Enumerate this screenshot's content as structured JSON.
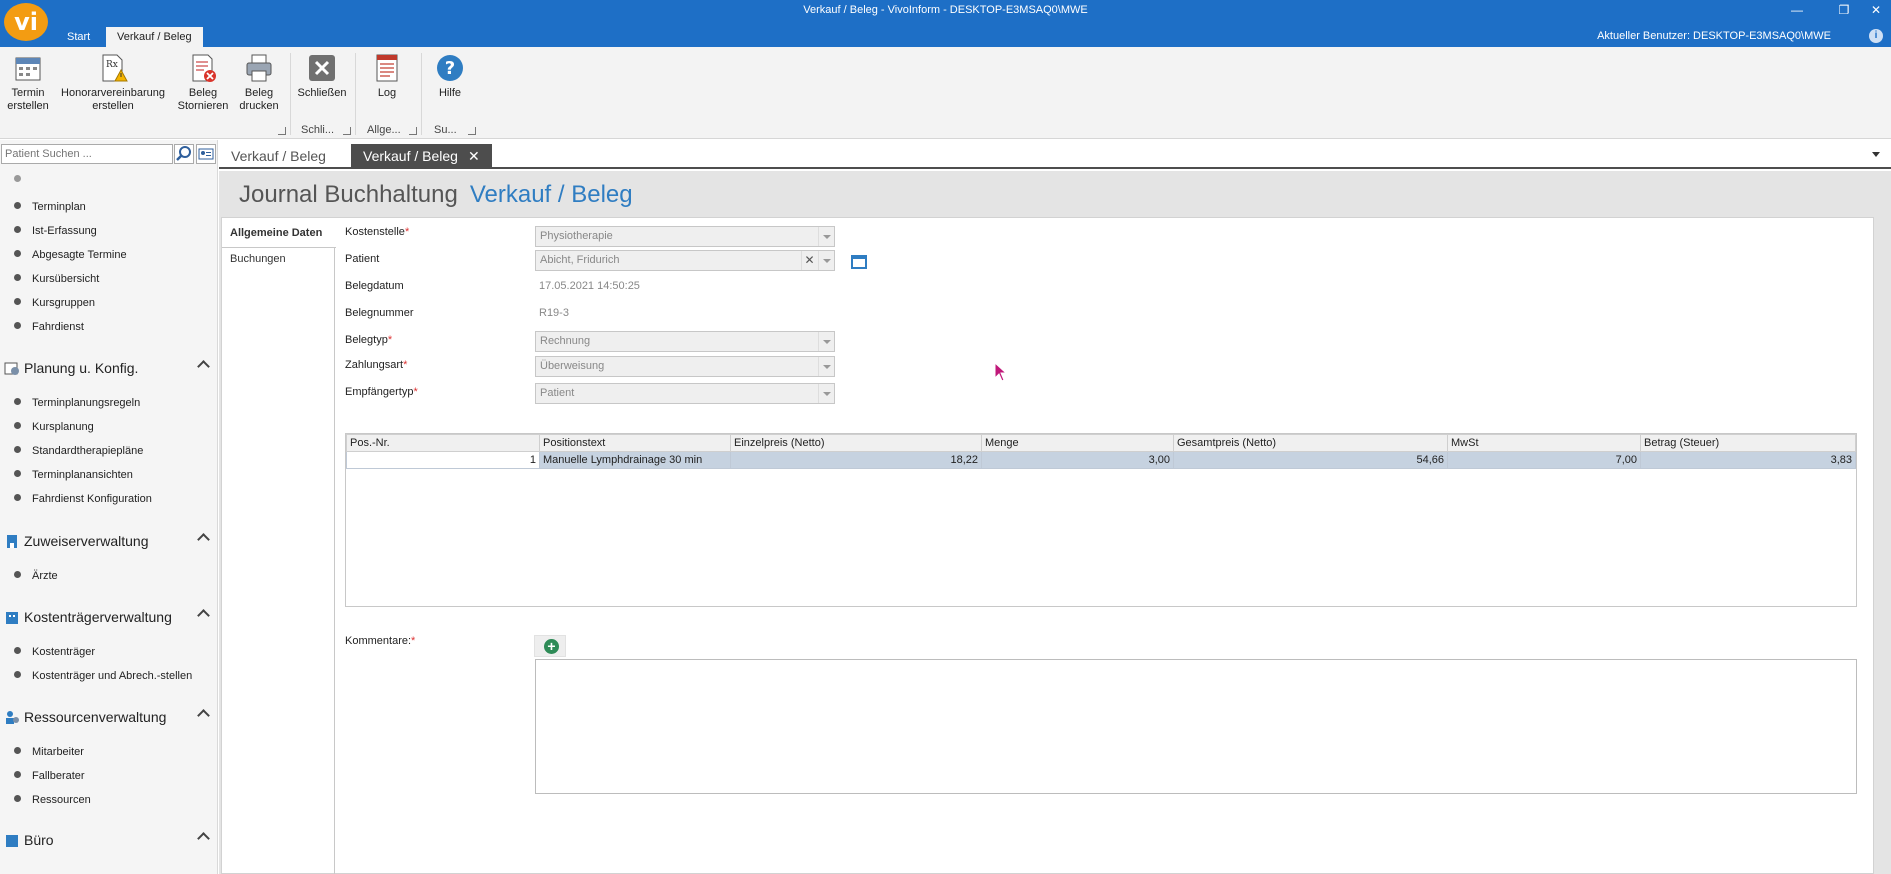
{
  "window": {
    "title": "Verkauf / Beleg - VivoInform - DESKTOP-E3MSAQ0\\MWE",
    "logo_text": "vi",
    "user_label": "Aktueller Benutzer: DESKTOP-E3MSAQ0\\MWE",
    "info_glyph": "i",
    "minimize_glyph": "—",
    "restore_glyph": "❐",
    "close_glyph": "✕"
  },
  "ribbon_tabs": [
    {
      "label": "Start"
    },
    {
      "label": "Verkauf / Beleg"
    }
  ],
  "ribbon": {
    "buttons": [
      {
        "label": "Termin\nerstellen",
        "icon": "calendar-icon"
      },
      {
        "label": "Honorarvereinbarung\nerstellen",
        "icon": "prescription-warning-icon"
      },
      {
        "label": "Beleg\nStornieren",
        "icon": "cancel-document-icon"
      },
      {
        "label": "Beleg\ndrucken",
        "icon": "printer-icon"
      },
      {
        "label": "Schließen",
        "icon": "close-box-icon"
      },
      {
        "label": "Log",
        "icon": "log-icon"
      },
      {
        "label": "Hilfe",
        "icon": "help-icon"
      }
    ],
    "groups": [
      "Schli...",
      "Allge...",
      "Su..."
    ]
  },
  "left_panel": {
    "search_placeholder": "Patient Suchen ...",
    "top_items": [
      "Terminplan",
      "Ist-Erfassung",
      "Abgesagte Termine",
      "Kursübersicht",
      "Kursgruppen",
      "Fahrdienst"
    ],
    "sections": [
      {
        "title": "Planung u. Konfig.",
        "items": [
          "Terminplanungsregeln",
          "Kursplanung",
          "Standardtherapiepläne",
          "Terminplanansichten",
          "Fahrdienst Konfiguration"
        ]
      },
      {
        "title": "Zuweiserverwaltung",
        "items": [
          "Ärzte"
        ]
      },
      {
        "title": "Kostenträgerverwaltung",
        "items": [
          "Kostenträger",
          "Kostenträger und Abrech.-stellen"
        ]
      },
      {
        "title": "Ressourcenverwaltung",
        "items": [
          "Mitarbeiter",
          "Fallberater",
          "Ressourcen"
        ]
      },
      {
        "title": "Büro",
        "items": []
      }
    ]
  },
  "doc_tabs": [
    {
      "label": "Verkauf / Beleg"
    },
    {
      "label": "Verkauf / Beleg",
      "close": "✕"
    }
  ],
  "breadcrumb": {
    "parent": "Journal Buchhaltung",
    "current": "Verkauf / Beleg"
  },
  "side_tabs": [
    "Allgemeine Daten",
    "Buchungen"
  ],
  "form": {
    "kostenstelle": {
      "label": "Kostenstelle",
      "value": "Physiotherapie"
    },
    "patient": {
      "label": "Patient",
      "value": "Abicht, Fridurich",
      "clear_glyph": "✕"
    },
    "belegdatum": {
      "label": "Belegdatum",
      "value": "17.05.2021 14:50:25"
    },
    "belegnummer": {
      "label": "Belegnummer",
      "value": "R19-3"
    },
    "belegtyp": {
      "label": "Belegtyp",
      "value": "Rechnung"
    },
    "zahlungsart": {
      "label": "Zahlungsart",
      "value": "Überweisung"
    },
    "empfaengertyp": {
      "label": "Empfängertyp",
      "value": "Patient"
    },
    "required_mark": "*",
    "kommentare_label": "Kommentare:",
    "add_glyph": "+"
  },
  "grid": {
    "columns": [
      "Pos.-Nr.",
      "Positionstext",
      "Einzelpreis (Netto)",
      "Menge",
      "Gesamtpreis (Netto)",
      "MwSt",
      "Betrag (Steuer)"
    ],
    "rows": [
      [
        "1",
        "Manuelle Lymphdrainage 30 min",
        "18,22",
        "3,00",
        "54,66",
        "7,00",
        "3,83"
      ]
    ]
  },
  "colors": {
    "titlebar": "#1e6fc6",
    "logo": "#f39c12",
    "accent": "#2f7dc2",
    "selected_row": "#c6d2e0"
  }
}
